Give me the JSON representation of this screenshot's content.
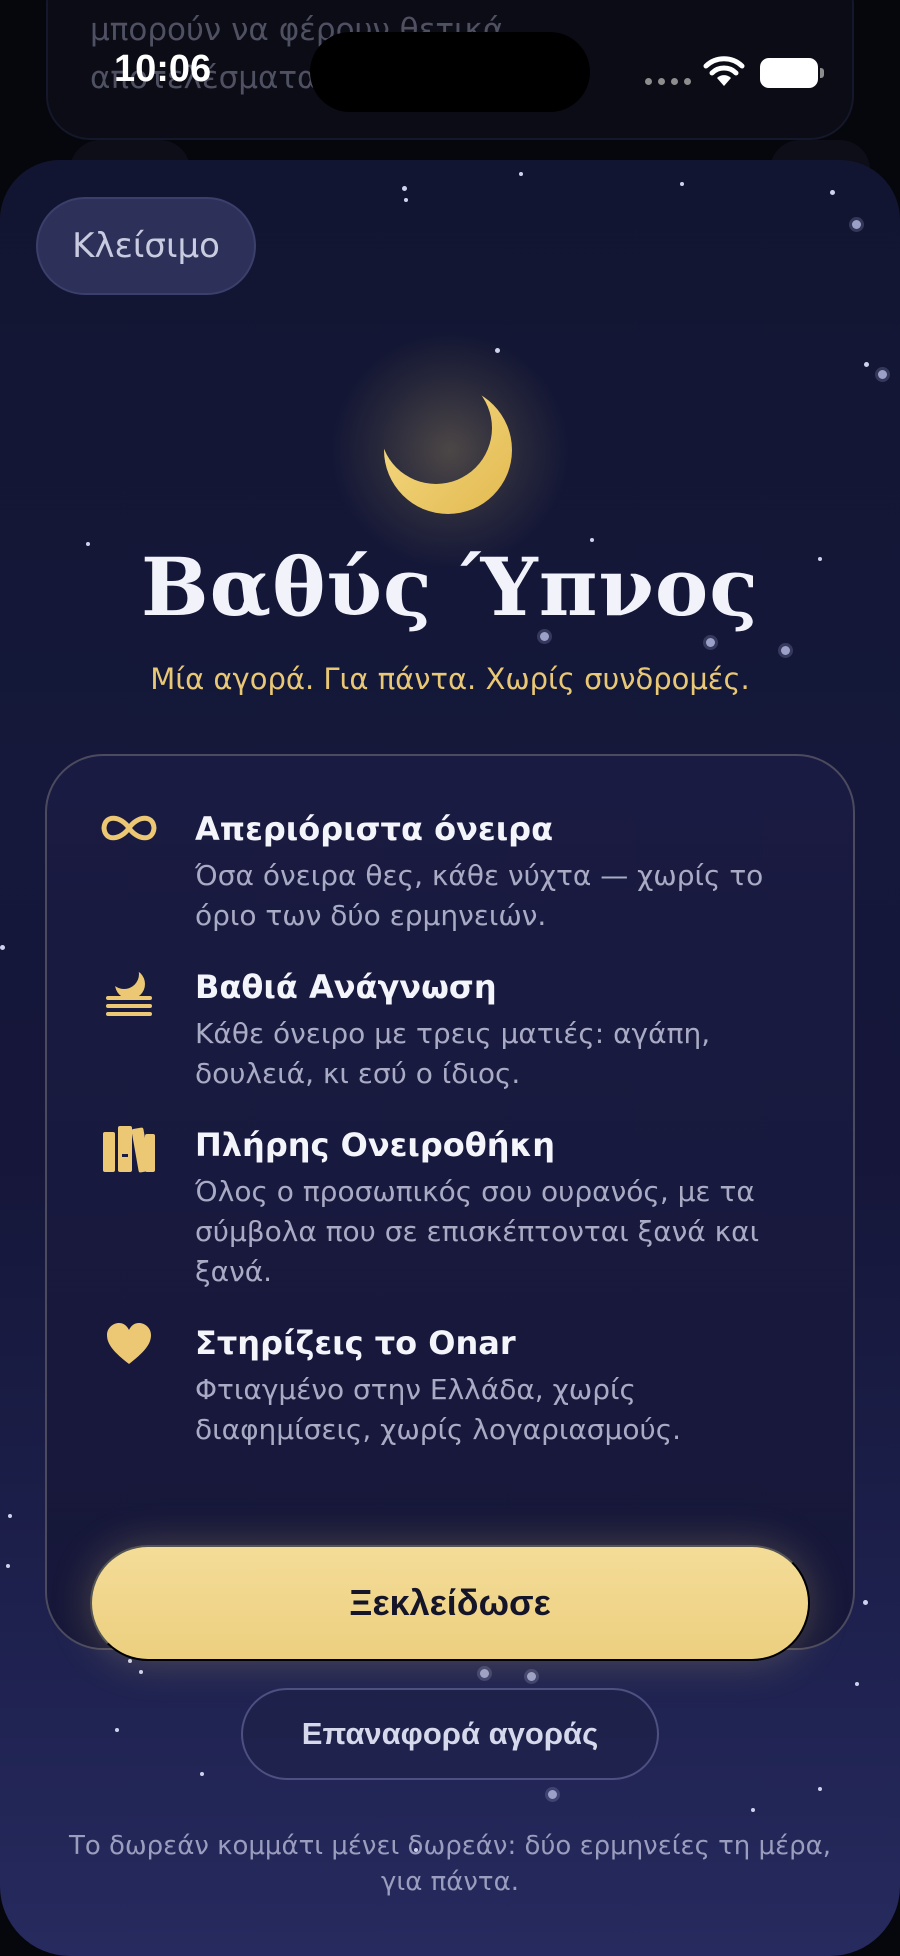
{
  "background": {
    "text": "μπορούν να φέρουν θετικά αποτελέσματα"
  },
  "status_bar": {
    "time": "10:06"
  },
  "sheet": {
    "close_label": "Κλείσιμο",
    "moon_icon": "crescent-moon-icon",
    "title": "Βαθύς Ύπνος",
    "subtitle": "Μία αγορά. Για πάντα. Χωρίς συνδρομές.",
    "features": [
      {
        "icon": "infinity-icon",
        "heading": "Απεριόριστα όνειρα",
        "description": "Όσα όνειρα θες, κάθε νύχτα — χωρίς το όριο των δύο ερμηνειών."
      },
      {
        "icon": "moon-haze-icon",
        "heading": "Βαθιά Ανάγνωση",
        "description": "Κάθε όνειρο με τρεις ματιές: αγάπη, δουλειά, κι εσύ ο ίδιος."
      },
      {
        "icon": "books-icon",
        "heading": "Πλήρης Ονειροθήκη",
        "description": "Όλος ο προσωπικός σου ουρανός, με τα σύμβολα που σε επισκέπτονται ξανά και ξανά."
      },
      {
        "icon": "heart-icon",
        "heading": "Στηρίζεις το Onar",
        "description": "Φτιαγμένο στην Ελλάδα, χωρίς διαφημίσεις, χωρίς λογαριασμούς."
      }
    ],
    "unlock_label": "Ξεκλείδωσε",
    "restore_label": "Επαναφορά αγοράς",
    "footer": "Το δωρεάν κομμάτι μένει δωρεάν: δύο ερμηνείες τη μέρα, για πάντα."
  },
  "colors": {
    "accent_gold": "#ECCF7F",
    "sheet_top": "#121531",
    "sheet_bottom": "#262A5E"
  }
}
